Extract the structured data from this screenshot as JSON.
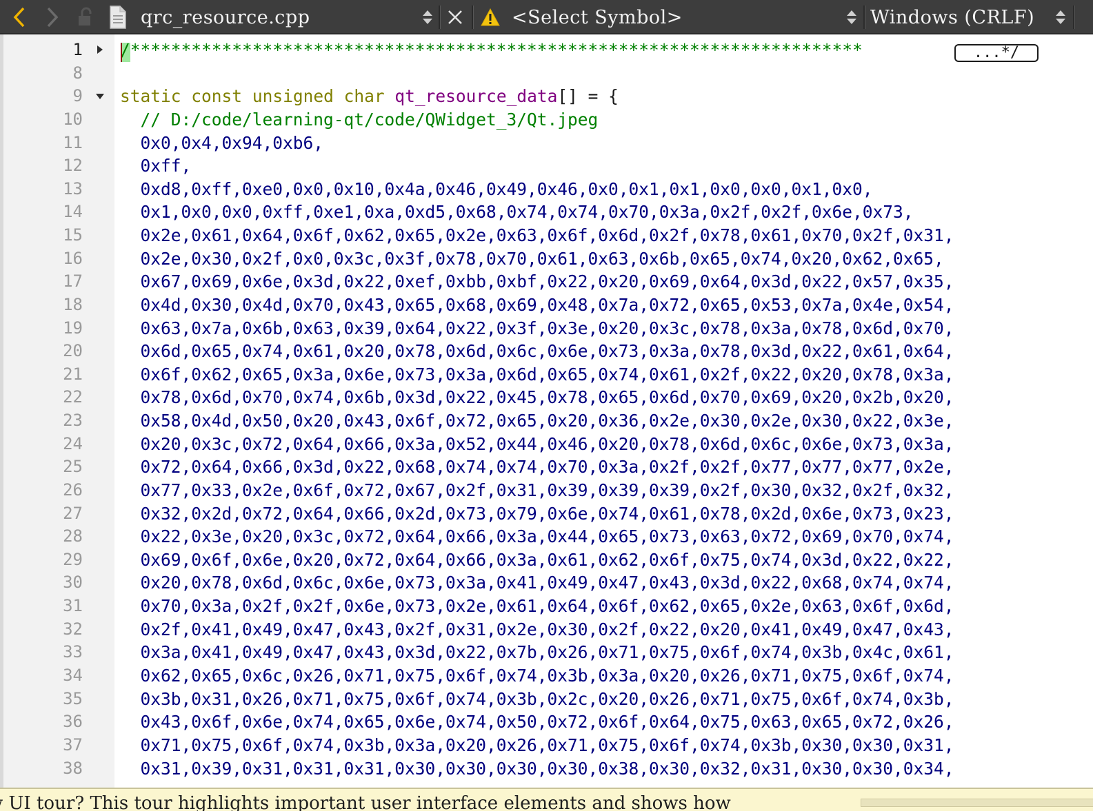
{
  "toolbar": {
    "file_name": "qrc_resource.cpp",
    "symbol_selector": "<Select Symbol>",
    "line_ending": "Windows (CRLF)",
    "icons": [
      "back-arrow-icon",
      "forward-arrow-icon",
      "lock-icon",
      "document-icon",
      "close-icon",
      "warning-icon"
    ]
  },
  "editor": {
    "lines": [
      {
        "num": "1",
        "fold": "collapsed",
        "text": "/************************************************************************",
        "fold_marker": "...*/"
      },
      {
        "num": "8",
        "fold": "",
        "text": ""
      },
      {
        "num": "9",
        "fold": "expanded",
        "tokens": [
          {
            "t": "static",
            "c": "kw"
          },
          {
            "t": " ",
            "c": "pn"
          },
          {
            "t": "const",
            "c": "kw"
          },
          {
            "t": " ",
            "c": "pn"
          },
          {
            "t": "unsigned",
            "c": "kw"
          },
          {
            "t": " ",
            "c": "pn"
          },
          {
            "t": "char",
            "c": "kw"
          },
          {
            "t": " ",
            "c": "pn"
          },
          {
            "t": "qt_resource_data",
            "c": "fn"
          },
          {
            "t": "[] = {",
            "c": "pn"
          }
        ]
      },
      {
        "num": "10",
        "fold": "",
        "comment": "  // D:/code/learning-qt/code/QWidget_3/Qt.jpeg"
      },
      {
        "num": "11",
        "fold": "",
        "hex": "  0x0,0x4,0x94,0xb6,"
      },
      {
        "num": "12",
        "fold": "",
        "hex": "  0xff,"
      },
      {
        "num": "13",
        "fold": "",
        "hex": "  0xd8,0xff,0xe0,0x0,0x10,0x4a,0x46,0x49,0x46,0x0,0x1,0x1,0x0,0x0,0x1,0x0,"
      },
      {
        "num": "14",
        "fold": "",
        "hex": "  0x1,0x0,0x0,0xff,0xe1,0xa,0xd5,0x68,0x74,0x74,0x70,0x3a,0x2f,0x2f,0x6e,0x73,"
      },
      {
        "num": "15",
        "fold": "",
        "hex": "  0x2e,0x61,0x64,0x6f,0x62,0x65,0x2e,0x63,0x6f,0x6d,0x2f,0x78,0x61,0x70,0x2f,0x31,"
      },
      {
        "num": "16",
        "fold": "",
        "hex": "  0x2e,0x30,0x2f,0x0,0x3c,0x3f,0x78,0x70,0x61,0x63,0x6b,0x65,0x74,0x20,0x62,0x65,"
      },
      {
        "num": "17",
        "fold": "",
        "hex": "  0x67,0x69,0x6e,0x3d,0x22,0xef,0xbb,0xbf,0x22,0x20,0x69,0x64,0x3d,0x22,0x57,0x35,"
      },
      {
        "num": "18",
        "fold": "",
        "hex": "  0x4d,0x30,0x4d,0x70,0x43,0x65,0x68,0x69,0x48,0x7a,0x72,0x65,0x53,0x7a,0x4e,0x54,"
      },
      {
        "num": "19",
        "fold": "",
        "hex": "  0x63,0x7a,0x6b,0x63,0x39,0x64,0x22,0x3f,0x3e,0x20,0x3c,0x78,0x3a,0x78,0x6d,0x70,"
      },
      {
        "num": "20",
        "fold": "",
        "hex": "  0x6d,0x65,0x74,0x61,0x20,0x78,0x6d,0x6c,0x6e,0x73,0x3a,0x78,0x3d,0x22,0x61,0x64,"
      },
      {
        "num": "21",
        "fold": "",
        "hex": "  0x6f,0x62,0x65,0x3a,0x6e,0x73,0x3a,0x6d,0x65,0x74,0x61,0x2f,0x22,0x20,0x78,0x3a,"
      },
      {
        "num": "22",
        "fold": "",
        "hex": "  0x78,0x6d,0x70,0x74,0x6b,0x3d,0x22,0x45,0x78,0x65,0x6d,0x70,0x69,0x20,0x2b,0x20,"
      },
      {
        "num": "23",
        "fold": "",
        "hex": "  0x58,0x4d,0x50,0x20,0x43,0x6f,0x72,0x65,0x20,0x36,0x2e,0x30,0x2e,0x30,0x22,0x3e,"
      },
      {
        "num": "24",
        "fold": "",
        "hex": "  0x20,0x3c,0x72,0x64,0x66,0x3a,0x52,0x44,0x46,0x20,0x78,0x6d,0x6c,0x6e,0x73,0x3a,"
      },
      {
        "num": "25",
        "fold": "",
        "hex": "  0x72,0x64,0x66,0x3d,0x22,0x68,0x74,0x74,0x70,0x3a,0x2f,0x2f,0x77,0x77,0x77,0x2e,"
      },
      {
        "num": "26",
        "fold": "",
        "hex": "  0x77,0x33,0x2e,0x6f,0x72,0x67,0x2f,0x31,0x39,0x39,0x39,0x2f,0x30,0x32,0x2f,0x32,"
      },
      {
        "num": "27",
        "fold": "",
        "hex": "  0x32,0x2d,0x72,0x64,0x66,0x2d,0x73,0x79,0x6e,0x74,0x61,0x78,0x2d,0x6e,0x73,0x23,"
      },
      {
        "num": "28",
        "fold": "",
        "hex": "  0x22,0x3e,0x20,0x3c,0x72,0x64,0x66,0x3a,0x44,0x65,0x73,0x63,0x72,0x69,0x70,0x74,"
      },
      {
        "num": "29",
        "fold": "",
        "hex": "  0x69,0x6f,0x6e,0x20,0x72,0x64,0x66,0x3a,0x61,0x62,0x6f,0x75,0x74,0x3d,0x22,0x22,"
      },
      {
        "num": "30",
        "fold": "",
        "hex": "  0x20,0x78,0x6d,0x6c,0x6e,0x73,0x3a,0x41,0x49,0x47,0x43,0x3d,0x22,0x68,0x74,0x74,"
      },
      {
        "num": "31",
        "fold": "",
        "hex": "  0x70,0x3a,0x2f,0x2f,0x6e,0x73,0x2e,0x61,0x64,0x6f,0x62,0x65,0x2e,0x63,0x6f,0x6d,"
      },
      {
        "num": "32",
        "fold": "",
        "hex": "  0x2f,0x41,0x49,0x47,0x43,0x2f,0x31,0x2e,0x30,0x2f,0x22,0x20,0x41,0x49,0x47,0x43,"
      },
      {
        "num": "33",
        "fold": "",
        "hex": "  0x3a,0x41,0x49,0x47,0x43,0x3d,0x22,0x7b,0x26,0x71,0x75,0x6f,0x74,0x3b,0x4c,0x61,"
      },
      {
        "num": "34",
        "fold": "",
        "hex": "  0x62,0x65,0x6c,0x26,0x71,0x75,0x6f,0x74,0x3b,0x3a,0x20,0x26,0x71,0x75,0x6f,0x74,"
      },
      {
        "num": "35",
        "fold": "",
        "hex": "  0x3b,0x31,0x26,0x71,0x75,0x6f,0x74,0x3b,0x2c,0x20,0x26,0x71,0x75,0x6f,0x74,0x3b,"
      },
      {
        "num": "36",
        "fold": "",
        "hex": "  0x43,0x6f,0x6e,0x74,0x65,0x6e,0x74,0x50,0x72,0x6f,0x64,0x75,0x63,0x65,0x72,0x26,"
      },
      {
        "num": "37",
        "fold": "",
        "hex": "  0x71,0x75,0x6f,0x74,0x3b,0x3a,0x20,0x26,0x71,0x75,0x6f,0x74,0x3b,0x30,0x30,0x31,"
      },
      {
        "num": "38",
        "fold": "",
        "hex": "  0x31,0x39,0x31,0x31,0x31,0x30,0x30,0x30,0x30,0x38,0x30,0x32,0x31,0x30,0x30,0x34,"
      }
    ]
  },
  "banner": {
    "text": "w UI tour? This tour highlights important user interface elements and shows how"
  },
  "colors": {
    "toolbar_bg": "#3d3d3d",
    "keyword": "#808000",
    "function_name": "#800080",
    "comment": "#008000",
    "hex_literal": "#000080",
    "banner_bg": "#fbf6cf"
  }
}
